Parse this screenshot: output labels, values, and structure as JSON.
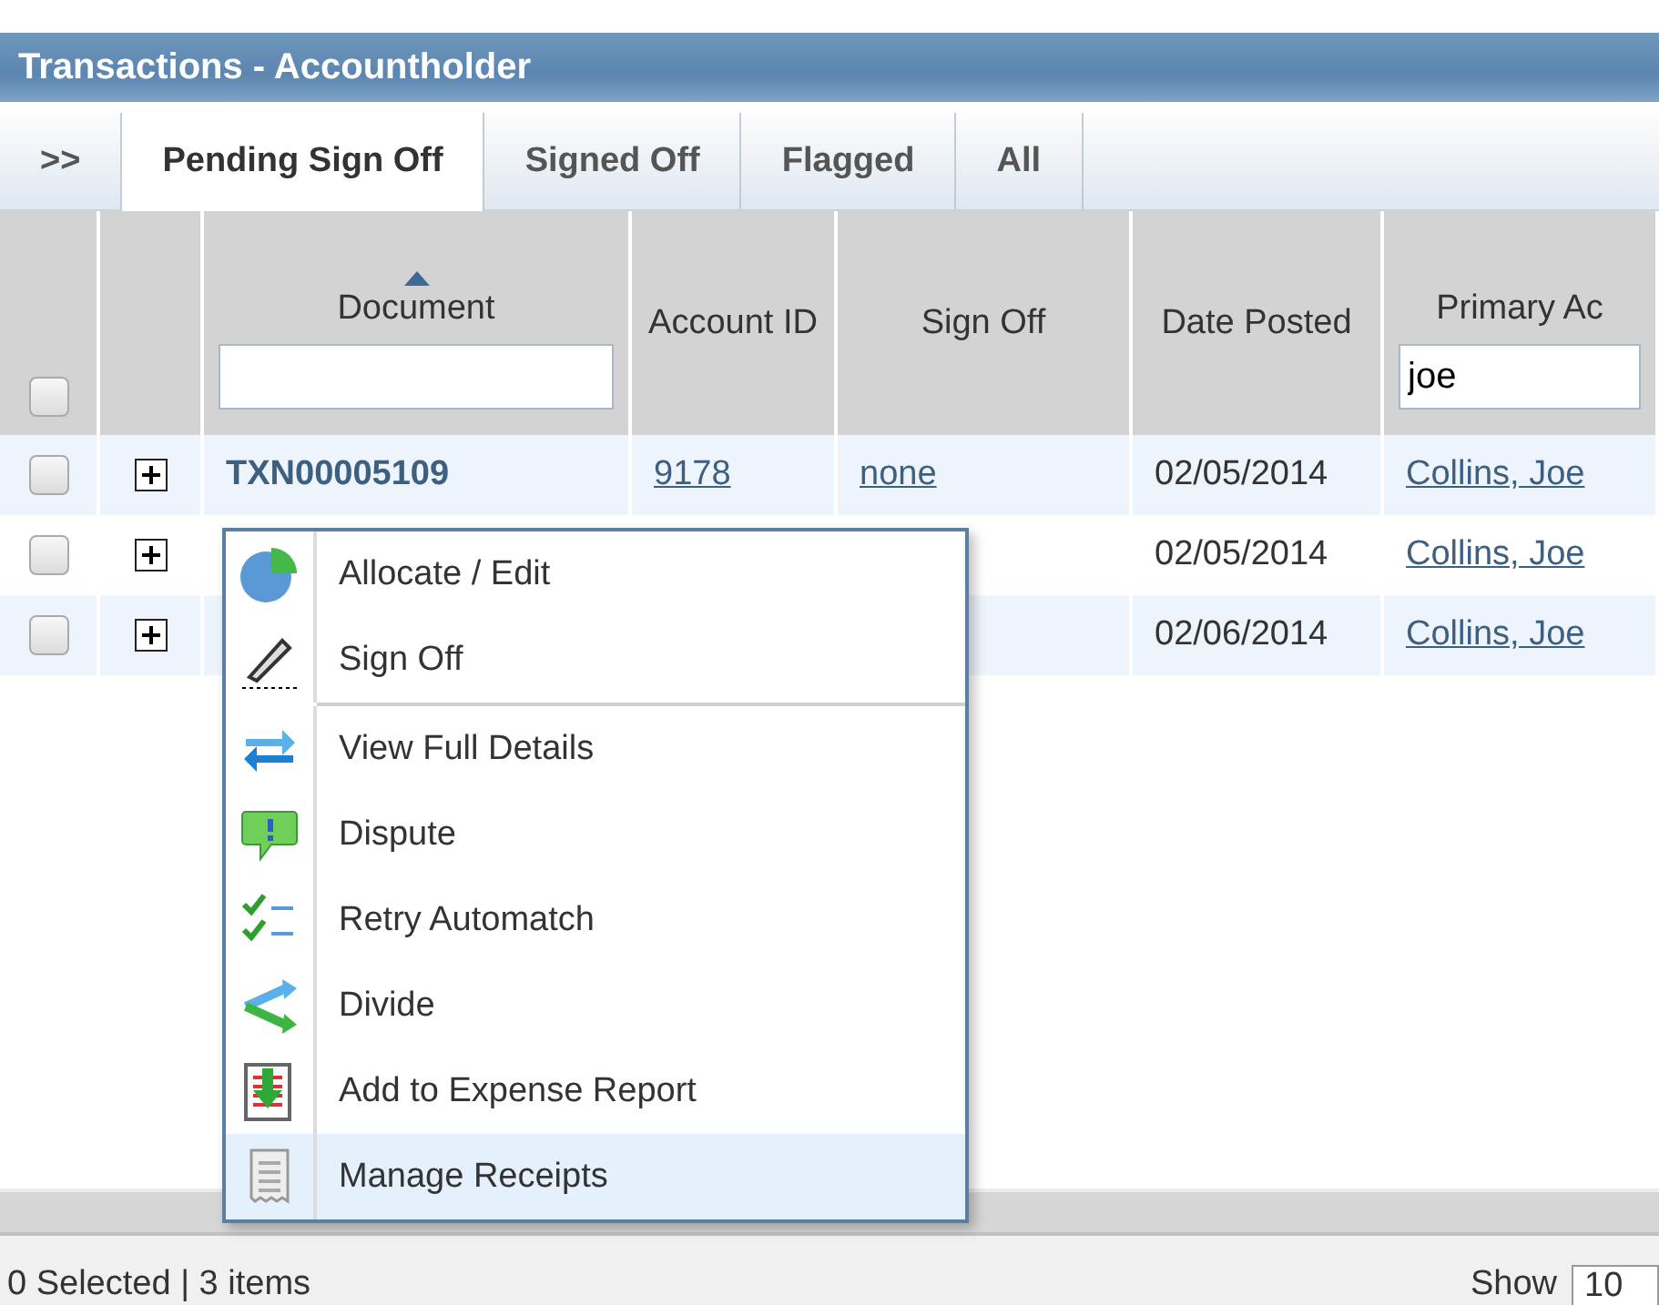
{
  "window": {
    "title": "Transactions - Accountholder"
  },
  "tabs": [
    {
      "label": ">>",
      "selected": false
    },
    {
      "label": "Pending Sign Off",
      "selected": true
    },
    {
      "label": "Signed Off",
      "selected": false
    },
    {
      "label": "Flagged",
      "selected": false
    },
    {
      "label": "All",
      "selected": false
    }
  ],
  "table": {
    "select_all_checked": false,
    "columns": [
      {
        "label": "Document",
        "sorted": true,
        "filterable": true
      },
      {
        "label": "Account ID"
      },
      {
        "label": "Sign Off"
      },
      {
        "label": "Date Posted"
      },
      {
        "label": "Primary Ac",
        "filterable": true,
        "filter_value": "joe"
      }
    ],
    "rows": [
      {
        "checked": false,
        "expanded": false,
        "document": "TXN00005109",
        "account_id": "9178",
        "sign_off": "none",
        "date_posted": "02/05/2014",
        "primary": "Collins, Joe"
      },
      {
        "checked": false,
        "expanded": false,
        "date_posted": "02/05/2014",
        "primary": "Collins, Joe"
      },
      {
        "checked": false,
        "expanded": false,
        "date_posted": "02/06/2014",
        "primary": "Collins, Joe"
      }
    ]
  },
  "context_menu": {
    "groups": [
      [
        {
          "label": "Allocate / Edit",
          "selected": false
        },
        {
          "label": "Sign Off",
          "selected": false
        }
      ],
      [
        {
          "label": "View Full Details",
          "selected": false
        },
        {
          "label": "Dispute",
          "selected": false
        },
        {
          "label": "Retry Automatch",
          "selected": false
        },
        {
          "label": "Divide",
          "selected": false
        },
        {
          "label": "Add to Expense Report",
          "selected": false
        },
        {
          "label": "Manage Receipts",
          "selected": true
        }
      ]
    ]
  },
  "status_bar": {
    "summary": "0 Selected | 3 items",
    "show_label": "Show",
    "page_size": "10"
  }
}
